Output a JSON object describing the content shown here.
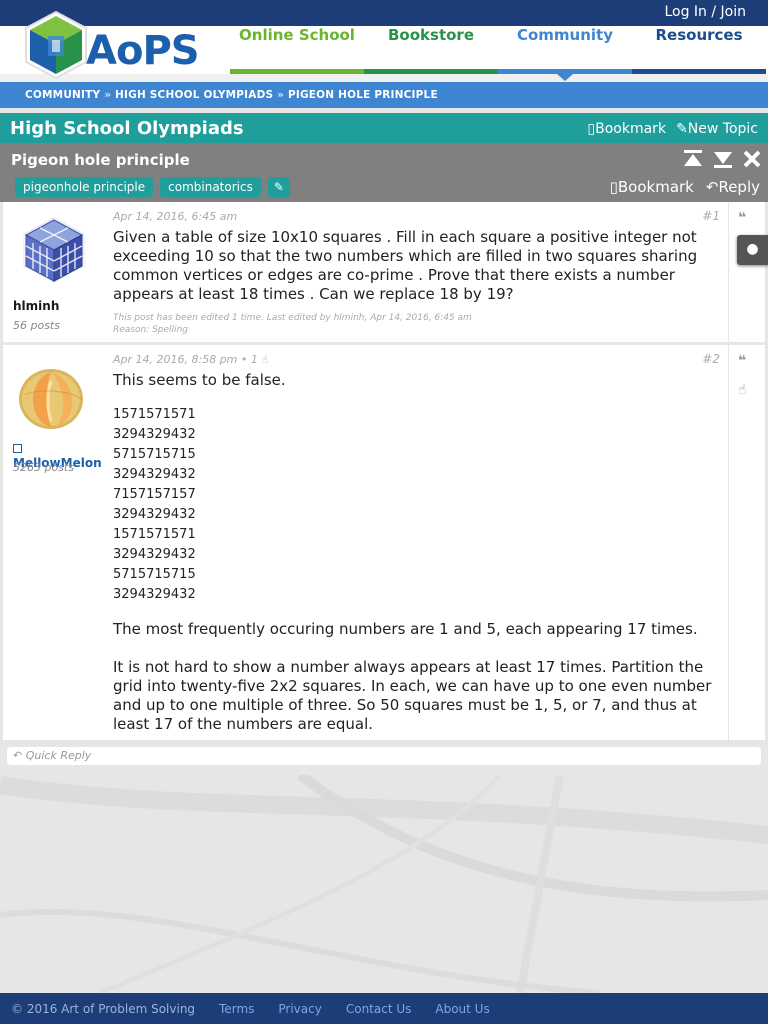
{
  "topbar": {
    "login": "Log In / Join"
  },
  "logo": {
    "text": "AoPS"
  },
  "nav": [
    {
      "label": "Online School",
      "color": "#6ab52f"
    },
    {
      "label": "Bookstore",
      "color": "#28924b"
    },
    {
      "label": "Community",
      "color": "#3e86d1"
    },
    {
      "label": "Resources",
      "color": "#1c4d91"
    }
  ],
  "breadcrumb": {
    "items": [
      "COMMUNITY",
      "HIGH SCHOOL OLYMPIADS",
      "PIGEON HOLE PRINCIPLE"
    ],
    "sep": "»"
  },
  "forum": {
    "title": "High School Olympiads",
    "bookmark": "Bookmark",
    "new_topic": "New Topic"
  },
  "topic": {
    "title": "Pigeon hole principle",
    "tags": [
      "pigeonhole principle",
      "combinatorics"
    ],
    "bookmark": "Bookmark",
    "reply": "Reply"
  },
  "posts": [
    {
      "author": "hlminh",
      "post_count": "56 posts",
      "date": "Apr 14, 2016, 6:45 am",
      "number": "#1",
      "text": "Given a table of size 10x10 squares . Fill in each square a positive integer not exceeding 10 so that the two numbers which are filled in two squares sharing common vertices or edges are co-prime . Prove that there exists a number appears at least 18 times . Can we replace 18 by 19?",
      "edit_note": "This post has been edited 1 time. Last edited by hlminh, Apr 14, 2016, 6:45 am",
      "edit_reason": "Reason: Spelling"
    },
    {
      "author": "MellowMelon",
      "post_count": "5263 posts",
      "date": "Apr 14, 2016, 8:58 pm",
      "likes": "• 1",
      "number": "#2",
      "intro": "This seems to be false.",
      "grid": [
        "1571571571",
        "3294329432",
        "5715715715",
        "3294329432",
        "7157157157",
        "3294329432",
        "1571571571",
        "3294329432",
        "5715715715",
        "3294329432"
      ],
      "p1": "The most frequently occuring numbers are 1 and 5, each appearing 17 times.",
      "p2": "It is not hard to show a number always appears at least 17 times. Partition the grid into twenty-five 2x2 squares. In each, we can have up to one even number and up to one multiple of three. So 50 squares must be 1, 5, or 7, and thus at least 17 of the numbers are equal."
    }
  ],
  "quick_reply": "Quick Reply",
  "footer": {
    "copyright": "© 2016 Art of Problem Solving",
    "links": [
      "Terms",
      "Privacy",
      "Contact Us",
      "About Us"
    ]
  }
}
